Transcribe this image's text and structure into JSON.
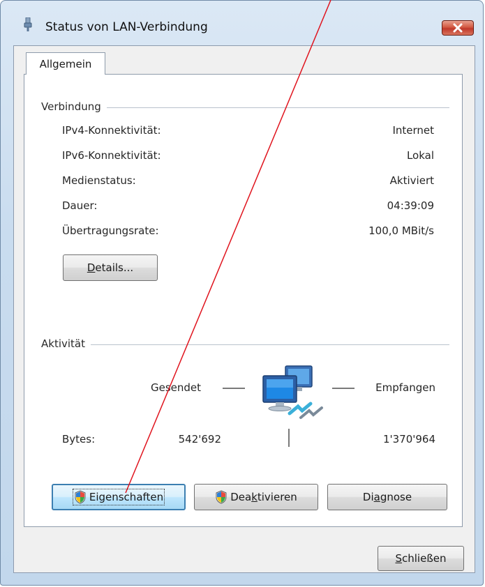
{
  "window": {
    "title": "Status von LAN-Verbindung"
  },
  "tabs": [
    {
      "label": "Allgemein"
    }
  ],
  "connection": {
    "group_label": "Verbindung",
    "rows": [
      {
        "label": "IPv4-Konnektivität:",
        "value": "Internet"
      },
      {
        "label": "IPv6-Konnektivität:",
        "value": "Lokal"
      },
      {
        "label": "Medienstatus:",
        "value": "Aktiviert"
      },
      {
        "label": "Dauer:",
        "value": "04:39:09"
      },
      {
        "label": "Übertragungsrate:",
        "value": "100,0 MBit/s"
      }
    ],
    "details_button": {
      "mnemonic": "D",
      "rest": "etails..."
    }
  },
  "activity": {
    "group_label": "Aktivität",
    "sent_label": "Gesendet",
    "received_label": "Empfangen",
    "bytes_label": "Bytes:",
    "bytes_sent": "542'692",
    "bytes_received": "1'370'964"
  },
  "buttons": {
    "properties": {
      "label": "Eigenschaften",
      "icon": "uac-shield-icon"
    },
    "deactivate": {
      "before": "Dea",
      "mnemonic": "k",
      "after": "tivieren",
      "icon": "uac-shield-icon"
    },
    "diagnose": {
      "before": "Di",
      "mnemonic": "a",
      "after": "gnose"
    },
    "close": {
      "mnemonic": "S",
      "rest": "chließen"
    }
  },
  "colors": {
    "annotation_line": "#e0141e",
    "accent": "#3c7fb1"
  }
}
